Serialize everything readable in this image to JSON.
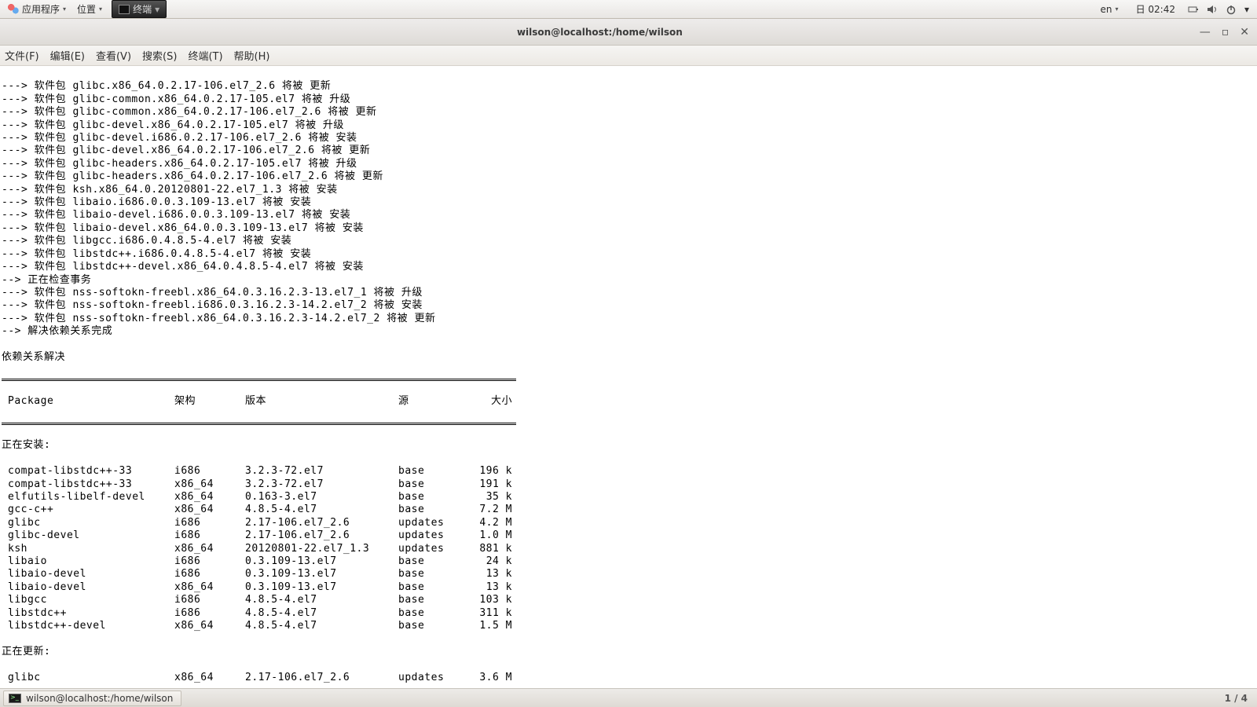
{
  "top_panel": {
    "applications": "应用程序",
    "places": "位置",
    "active_app": "终端",
    "lang": "en",
    "clock": "日 02:42"
  },
  "window": {
    "title": "wilson@localhost:/home/wilson"
  },
  "menubar": {
    "file": "文件(F)",
    "edit": "编辑(E)",
    "view": "查看(V)",
    "search": "搜索(S)",
    "terminal": "终端(T)",
    "help": "帮助(H)"
  },
  "terminal": {
    "pre_lines": [
      "---> 软件包 glibc.x86_64.0.2.17-106.el7_2.6 将被 更新",
      "---> 软件包 glibc-common.x86_64.0.2.17-105.el7 将被 升级",
      "---> 软件包 glibc-common.x86_64.0.2.17-106.el7_2.6 将被 更新",
      "---> 软件包 glibc-devel.x86_64.0.2.17-105.el7 将被 升级",
      "---> 软件包 glibc-devel.i686.0.2.17-106.el7_2.6 将被 安装",
      "---> 软件包 glibc-devel.x86_64.0.2.17-106.el7_2.6 将被 更新",
      "---> 软件包 glibc-headers.x86_64.0.2.17-105.el7 将被 升级",
      "---> 软件包 glibc-headers.x86_64.0.2.17-106.el7_2.6 将被 更新",
      "---> 软件包 ksh.x86_64.0.20120801-22.el7_1.3 将被 安装",
      "---> 软件包 libaio.i686.0.0.3.109-13.el7 将被 安装",
      "---> 软件包 libaio-devel.i686.0.0.3.109-13.el7 将被 安装",
      "---> 软件包 libaio-devel.x86_64.0.0.3.109-13.el7 将被 安装",
      "---> 软件包 libgcc.i686.0.4.8.5-4.el7 将被 安装",
      "---> 软件包 libstdc++.i686.0.4.8.5-4.el7 将被 安装",
      "---> 软件包 libstdc++-devel.x86_64.0.4.8.5-4.el7 将被 安装",
      "--> 正在检查事务",
      "---> 软件包 nss-softokn-freebl.x86_64.0.3.16.2.3-13.el7_1 将被 升级",
      "---> 软件包 nss-softokn-freebl.i686.0.3.16.2.3-14.2.el7_2 将被 安装",
      "---> 软件包 nss-softokn-freebl.x86_64.0.3.16.2.3-14.2.el7_2 将被 更新",
      "--> 解决依赖关系完成",
      "",
      "依赖关系解决",
      ""
    ],
    "header": {
      "pkg": "Package",
      "arch": "架构",
      "ver": "版本",
      "src": "源",
      "size": "大小"
    },
    "installing_label": "正在安装:",
    "installing": [
      {
        "pkg": "compat-libstdc++-33",
        "arch": "i686",
        "ver": "3.2.3-72.el7",
        "src": "base",
        "size": "196 k"
      },
      {
        "pkg": "compat-libstdc++-33",
        "arch": "x86_64",
        "ver": "3.2.3-72.el7",
        "src": "base",
        "size": "191 k"
      },
      {
        "pkg": "elfutils-libelf-devel",
        "arch": "x86_64",
        "ver": "0.163-3.el7",
        "src": "base",
        "size": "35 k"
      },
      {
        "pkg": "gcc-c++",
        "arch": "x86_64",
        "ver": "4.8.5-4.el7",
        "src": "base",
        "size": "7.2 M"
      },
      {
        "pkg": "glibc",
        "arch": "i686",
        "ver": "2.17-106.el7_2.6",
        "src": "updates",
        "size": "4.2 M"
      },
      {
        "pkg": "glibc-devel",
        "arch": "i686",
        "ver": "2.17-106.el7_2.6",
        "src": "updates",
        "size": "1.0 M"
      },
      {
        "pkg": "ksh",
        "arch": "x86_64",
        "ver": "20120801-22.el7_1.3",
        "src": "updates",
        "size": "881 k"
      },
      {
        "pkg": "libaio",
        "arch": "i686",
        "ver": "0.3.109-13.el7",
        "src": "base",
        "size": "24 k"
      },
      {
        "pkg": "libaio-devel",
        "arch": "i686",
        "ver": "0.3.109-13.el7",
        "src": "base",
        "size": "13 k"
      },
      {
        "pkg": "libaio-devel",
        "arch": "x86_64",
        "ver": "0.3.109-13.el7",
        "src": "base",
        "size": "13 k"
      },
      {
        "pkg": "libgcc",
        "arch": "i686",
        "ver": "4.8.5-4.el7",
        "src": "base",
        "size": "103 k"
      },
      {
        "pkg": "libstdc++",
        "arch": "i686",
        "ver": "4.8.5-4.el7",
        "src": "base",
        "size": "311 k"
      },
      {
        "pkg": "libstdc++-devel",
        "arch": "x86_64",
        "ver": "4.8.5-4.el7",
        "src": "base",
        "size": "1.5 M"
      }
    ],
    "updating_label": "正在更新:",
    "updating": [
      {
        "pkg": "glibc",
        "arch": "x86_64",
        "ver": "2.17-106.el7_2.6",
        "src": "updates",
        "size": "3.6 M"
      }
    ]
  },
  "bottom_panel": {
    "task": "wilson@localhost:/home/wilson",
    "workspace": "1 / 4"
  }
}
